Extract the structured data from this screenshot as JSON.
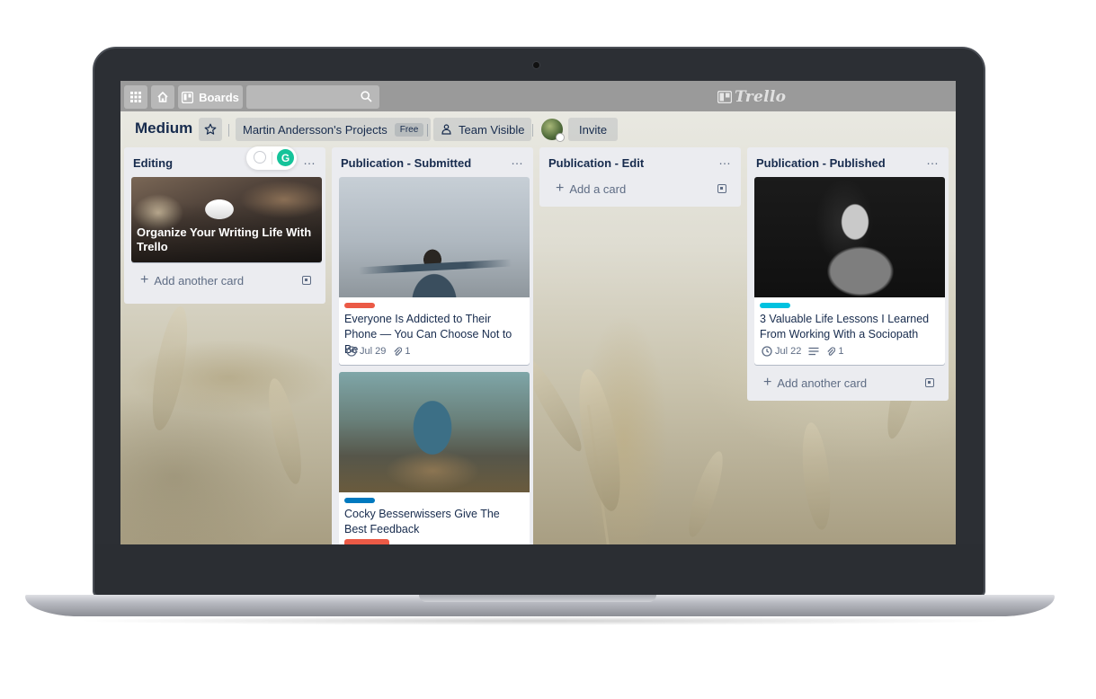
{
  "topbar": {
    "boards_label": "Boards",
    "search_placeholder": "",
    "logo_text": "Trello"
  },
  "board": {
    "title": "Medium",
    "team_name": "Martin Andersson's Projects",
    "team_badge": "Free",
    "visibility": "Team Visible",
    "invite_label": "Invite"
  },
  "lists": [
    {
      "title": "Editing",
      "menu": "…",
      "cards": [
        {
          "title": "Organize Your Writing Life With Trello"
        }
      ],
      "add_label": "Add another card"
    },
    {
      "title": "Publication - Submitted",
      "menu": "…",
      "cards": [
        {
          "title": "Everyone Is Addicted to Their Phone — You Can Choose Not to Be",
          "label_color": "#eb5a46",
          "due": "Jul 29",
          "attachments": "1"
        },
        {
          "title": "Cocky Besserwissers Give The Best Feedback",
          "label_color": "#0079bf"
        }
      ]
    },
    {
      "title": "Publication - Edit",
      "menu": "…",
      "add_label": "Add a card"
    },
    {
      "title": "Publication - Published",
      "menu": "…",
      "cards": [
        {
          "title": "3 Valuable Life Lessons I Learned From Working With a Sociopath",
          "label_color": "#00c2e0",
          "due": "Jul 22",
          "attachments": "1"
        }
      ],
      "add_label": "Add another card"
    }
  ],
  "colors": {
    "topbar": "#9a9a9a",
    "list_bg": "#ebecf0",
    "text_primary": "#172b4d",
    "text_muted": "#5e6c84",
    "grammarly": "#15c39a",
    "overdue_badge": "#eb5a46"
  }
}
